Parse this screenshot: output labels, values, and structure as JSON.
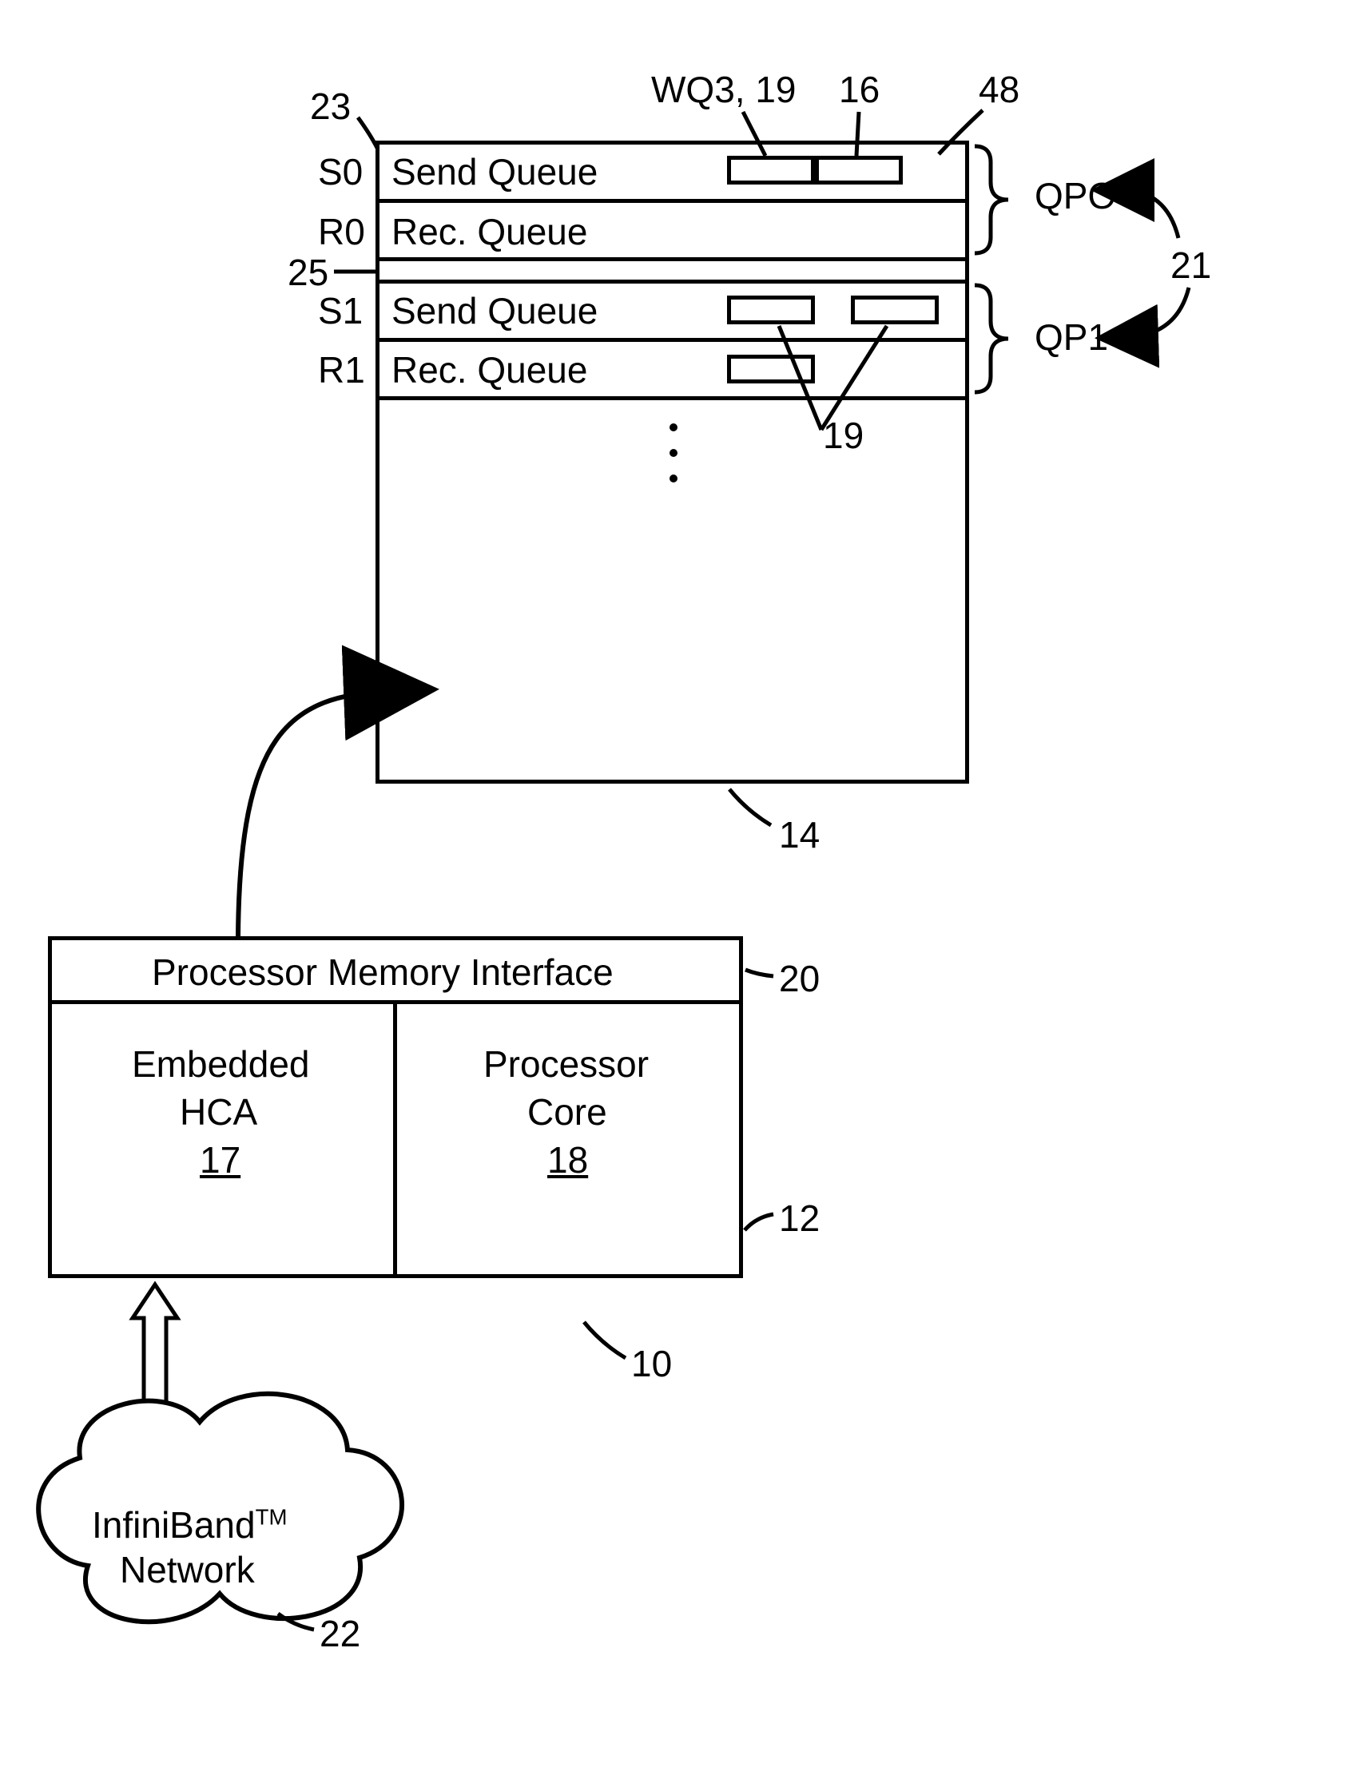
{
  "labels": {
    "wq3_19": "WQ3, 19",
    "n16": "16",
    "n48": "48",
    "n23": "23",
    "n25": "25",
    "n21": "21",
    "n19": "19",
    "n14": "14",
    "n20": "20",
    "n12": "12",
    "n10": "10",
    "n22": "22",
    "s0": "S0",
    "r0": "R0",
    "s1": "S1",
    "r1": "R1",
    "send_queue": "Send Queue",
    "rec_queue": "Rec. Queue",
    "qpo": "QPO",
    "qp1": "QP1",
    "pmi": "Processor Memory Interface",
    "emb_hca_l1": "Embedded",
    "emb_hca_l2": "HCA",
    "emb_hca_num": "17",
    "proc_core_l1": "Processor",
    "proc_core_l2": "Core",
    "proc_core_num": "18",
    "network_l1": "InfiniBand",
    "network_tm": "TM",
    "network_l2": "Network"
  }
}
